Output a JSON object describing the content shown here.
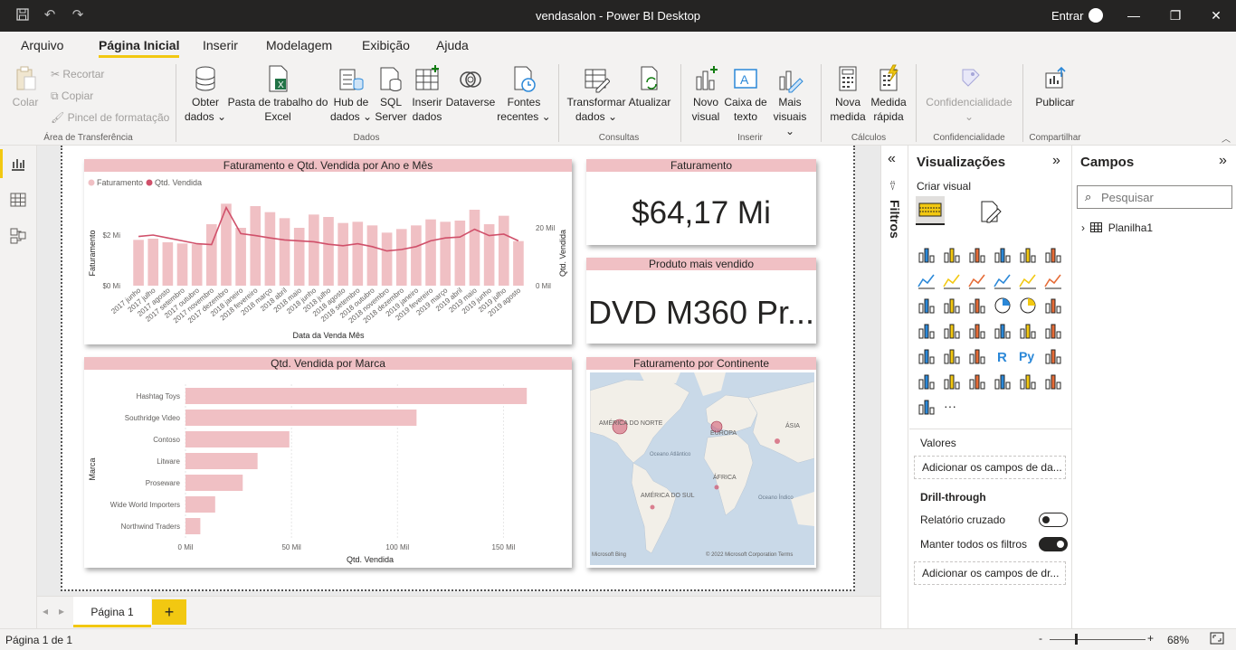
{
  "window": {
    "title": "vendasalon - Power BI Desktop",
    "signin": "Entrar"
  },
  "menu": {
    "items": [
      "Arquivo",
      "Página Inicial",
      "Inserir",
      "Modelagem",
      "Exibição",
      "Ajuda"
    ]
  },
  "ribbon": {
    "clipboard": {
      "paste": "Colar",
      "cut": "Recortar",
      "copy": "Copiar",
      "format_painter": "Pincel de formatação",
      "group": "Área de Transferência"
    },
    "data": {
      "get_data": [
        "Obter",
        "dados ⌄"
      ],
      "excel": [
        "Pasta de trabalho do",
        "Excel"
      ],
      "hub": [
        "Hub de",
        "dados ⌄"
      ],
      "sql": [
        "SQL",
        "Server"
      ],
      "insert": [
        "Inserir",
        "dados"
      ],
      "dataverse": "Dataverse",
      "sources": [
        "Fontes",
        "recentes ⌄"
      ],
      "group": "Dados"
    },
    "queries": {
      "transform": [
        "Transformar",
        "dados ⌄"
      ],
      "refresh": "Atualizar",
      "group": "Consultas"
    },
    "insert": {
      "new_visual": [
        "Novo",
        "visual"
      ],
      "textbox": [
        "Caixa de",
        "texto"
      ],
      "more_visuals": [
        "Mais",
        "visuais ⌄"
      ],
      "group": "Inserir"
    },
    "calc": {
      "new_measure": [
        "Nova",
        "medida"
      ],
      "quick_measure": [
        "Medida",
        "rápida"
      ],
      "group": "Cálculos"
    },
    "sensitivity": {
      "label": "Confidencialidade",
      "group": "Confidencialidade"
    },
    "share": {
      "publish": "Publicar",
      "group": "Compartilhar"
    }
  },
  "visuals": {
    "combo": {
      "title": "Faturamento e Qtd. Vendida por Ano e Mês",
      "legend": [
        "Faturamento",
        "Qtd. Vendida"
      ],
      "xlabel": "Data da Venda Mês",
      "ylabel_left": "Faturamento",
      "ylabel_right": "Qtd. Vendida",
      "left_ticks": [
        "$2 Mi",
        "$0 Mi"
      ],
      "right_ticks": [
        "20 Mil",
        "0 Mil"
      ]
    },
    "kpi_revenue": {
      "title": "Faturamento",
      "value": "$64,17 Mi"
    },
    "kpi_product": {
      "title": "Produto mais vendido",
      "value": "DVD M360 Pr..."
    },
    "bar": {
      "title": "Qtd. Vendida por Marca",
      "xlabel": "Qtd. Vendida",
      "ylabel": "Marca",
      "ticks": [
        "0 Mil",
        "50 Mil",
        "100 Mil",
        "150 Mil"
      ]
    },
    "map": {
      "title": "Faturamento por Continente",
      "labels": [
        "AMÉRICA DO NORTE",
        "EUROPA",
        "ÁSIA",
        "Oceano Atlântico",
        "ÁFRICA",
        "AMÉRICA DO SUL",
        "Oceano Índico"
      ],
      "credit": "© 2022 Microsoft Corporation  Terms",
      "brand": "Microsoft Bing"
    }
  },
  "chart_data": [
    {
      "type": "bar",
      "title": "Faturamento e Qtd. Vendida por Ano e Mês",
      "xlabel": "Data da Venda Mês",
      "ylabel": "Faturamento",
      "categories": [
        "2017 junho",
        "2017 julho",
        "2017 agosto",
        "2017 setembro",
        "2017 outubro",
        "2017 novembro",
        "2017 dezembro",
        "2018 janeiro",
        "2018 fevereiro",
        "2018 março",
        "2018 abril",
        "2018 maio",
        "2018 junho",
        "2018 julho",
        "2018 agosto",
        "2018 setembro",
        "2018 outubro",
        "2018 novembro",
        "2018 dezembro",
        "2019 janeiro",
        "2019 fevereiro",
        "2019 março",
        "2019 abril",
        "2019 maio",
        "2019 junho",
        "2019 julho",
        "2019 agosto"
      ],
      "series": [
        {
          "name": "Faturamento",
          "values": [
            1.9,
            1.95,
            1.8,
            1.75,
            1.72,
            2.55,
            3.4,
            2.4,
            3.3,
            3.05,
            2.8,
            2.4,
            2.95,
            2.85,
            2.6,
            2.65,
            2.5,
            2.2,
            2.35,
            2.5,
            2.75,
            2.65,
            2.7,
            3.15,
            2.55,
            2.9,
            1.85
          ]
        },
        {
          "name": "Qtd. Vendida",
          "values": [
            17000,
            17500,
            16500,
            15500,
            14500,
            14200,
            27000,
            18000,
            17300,
            16500,
            15800,
            15500,
            15200,
            14300,
            13800,
            14500,
            13500,
            12000,
            12500,
            13500,
            15500,
            16500,
            16800,
            19500,
            17300,
            17800,
            15500
          ]
        }
      ],
      "ylim": [
        0,
        3.6
      ],
      "y2lim": [
        0,
        30000
      ]
    },
    {
      "type": "bar",
      "title": "Qtd. Vendida por Marca",
      "xlabel": "Qtd. Vendida",
      "ylabel": "Marca",
      "categories": [
        "Hashtag Toys",
        "Southridge Video",
        "Contoso",
        "Litware",
        "Proseware",
        "Wide World Importers",
        "Northwind Traders"
      ],
      "values": [
        161000,
        109000,
        49000,
        34000,
        27000,
        14000,
        7000
      ],
      "xlim": [
        0,
        175000
      ]
    }
  ],
  "filters": {
    "label": "Filtros"
  },
  "vispane": {
    "title": "Visualizações",
    "create": "Criar visual",
    "values_label": "Valores",
    "add_fields": "Adicionar os campos de da...",
    "drill": "Drill-through",
    "cross_report": "Relatório cruzado",
    "keep_filters": "Manter todos os filtros",
    "add_drill": "Adicionar os campos de dr..."
  },
  "fieldspane": {
    "title": "Campos",
    "search_placeholder": "Pesquisar",
    "table": "Planilha1"
  },
  "tabs": {
    "page1": "Página 1",
    "add": "+"
  },
  "status": {
    "page": "Página 1 de 1",
    "zoom": "68%"
  },
  "colors": {
    "bar": "#f0c0c4",
    "line": "#d0506a",
    "accent": "#f2c811",
    "map_water": "#c9d9e8",
    "map_land": "#f2efe8"
  }
}
